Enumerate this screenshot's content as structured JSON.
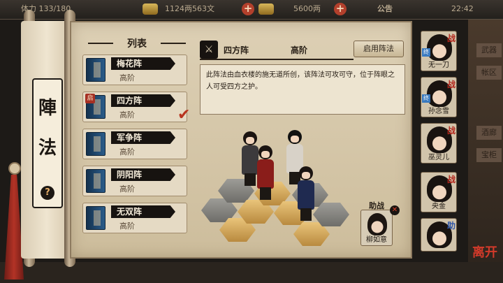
{
  "topbar": {
    "left_partial": "体力 133/180",
    "silver": "1124两563文",
    "gold": "5600两",
    "notice": "公告",
    "time": "22:42"
  },
  "scroll": {
    "title_chars": [
      "陣",
      "法"
    ],
    "help_glyph": "?"
  },
  "list": {
    "header": "列表",
    "items": [
      {
        "name": "梅花阵",
        "level": "高阶"
      },
      {
        "name": "四方阵",
        "level": "高阶",
        "tag": "启",
        "active": true
      },
      {
        "name": "军争阵",
        "level": "高阶"
      },
      {
        "name": "阴阳阵",
        "level": "高阶"
      },
      {
        "name": "无双阵",
        "level": "高阶"
      }
    ]
  },
  "detail": {
    "name": "四方阵",
    "level": "高阶",
    "enable_button": "启用阵法",
    "description": "此阵法由血衣楼的施无道所创，该阵法可攻可守，位于阵眼之人可受四方之护。"
  },
  "assist": {
    "label": "助战",
    "name": "柳如意"
  },
  "roster": [
    {
      "name": "无一刀",
      "badge": "战",
      "mark": "终"
    },
    {
      "name": "孙念雪",
      "badge": "战",
      "mark": "终"
    },
    {
      "name": "巫灵儿",
      "badge": "战",
      "mark": ""
    },
    {
      "name": "央金",
      "badge": "战",
      "mark": ""
    },
    {
      "name": "",
      "badge": "助",
      "mark": ""
    }
  ],
  "side_buttons": [
    "武器",
    "帐区",
    "酒廊",
    "宝柜"
  ],
  "leave_button": "离开"
}
